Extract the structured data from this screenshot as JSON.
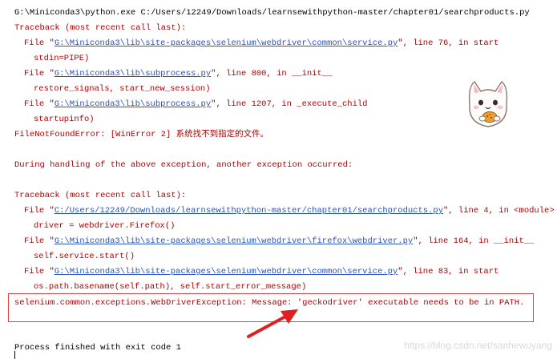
{
  "console": {
    "cmd": "G:\\Miniconda3\\python.exe C:/Users/12249/Downloads/learnsewithpython-master/chapter01/searchproducts.py",
    "tb1": "Traceback (most recent call last):",
    "f1_pre": "File \"",
    "f1_link": "G:\\Miniconda3\\lib\\site-packages\\selenium\\webdriver\\common\\service.py",
    "f1_post": "\", line 76, in start",
    "c1": "stdin=PIPE)",
    "f2_pre": "File \"",
    "f2_link": "G:\\Miniconda3\\lib\\subprocess.py",
    "f2_post": "\", line 800, in __init__",
    "c2": "restore_signals, start_new_session)",
    "f3_pre": "File \"",
    "f3_link": "G:\\Miniconda3\\lib\\subprocess.py",
    "f3_post": "\", line 1207, in _execute_child",
    "c3": "startupinfo)",
    "fnf": "FileNotFoundError: [WinError 2] 系统找不到指定的文件。",
    "during": "During handling of the above exception, another exception occurred:",
    "tb2": "Traceback (most recent call last):",
    "f4_pre": "File \"",
    "f4_link": "C:/Users/12249/Downloads/learnsewithpython-master/chapter01/searchproducts.py",
    "f4_post": "\", line 4, in <module>",
    "c4": "driver = webdriver.Firefox()",
    "f5_pre": "File \"",
    "f5_link": "G:\\Miniconda3\\lib\\site-packages\\selenium\\webdriver\\firefox\\webdriver.py",
    "f5_post": "\", line 164, in __init__",
    "c5": "self.service.start()",
    "f6_pre": "File \"",
    "f6_link": "G:\\Miniconda3\\lib\\site-packages\\selenium\\webdriver\\common\\service.py",
    "f6_post": "\", line 83, in start",
    "c6": "os.path.basename(self.path), self.start_error_message)",
    "final_err": "selenium.common.exceptions.WebDriverException: Message: 'geckodriver' executable needs to be in PATH.",
    "exit": "Process finished with exit code 1"
  },
  "watermark": "https://blog.csdn.net/sanhewuyang",
  "colors": {
    "error_text": "#b00000",
    "link": "#2a52be",
    "highlight_box": "#e04040",
    "arrow": "#e02020"
  }
}
